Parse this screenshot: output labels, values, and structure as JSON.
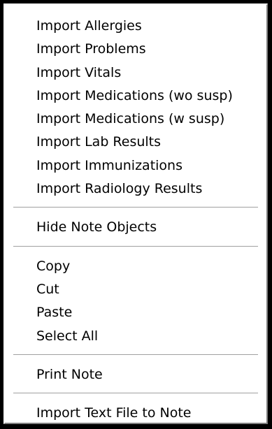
{
  "menu": {
    "group_import": [
      "Import Allergies",
      "Import Problems",
      "Import Vitals",
      "Import Medications (wo susp)",
      "Import Medications (w susp)",
      "Import Lab Results",
      "Import Immunizations",
      "Import Radiology Results"
    ],
    "hide_note_objects": "Hide Note Objects",
    "group_edit": [
      "Copy",
      "Cut",
      "Paste",
      "Select All"
    ],
    "print_note": "Print Note",
    "import_text_file": "Import Text File to Note"
  }
}
